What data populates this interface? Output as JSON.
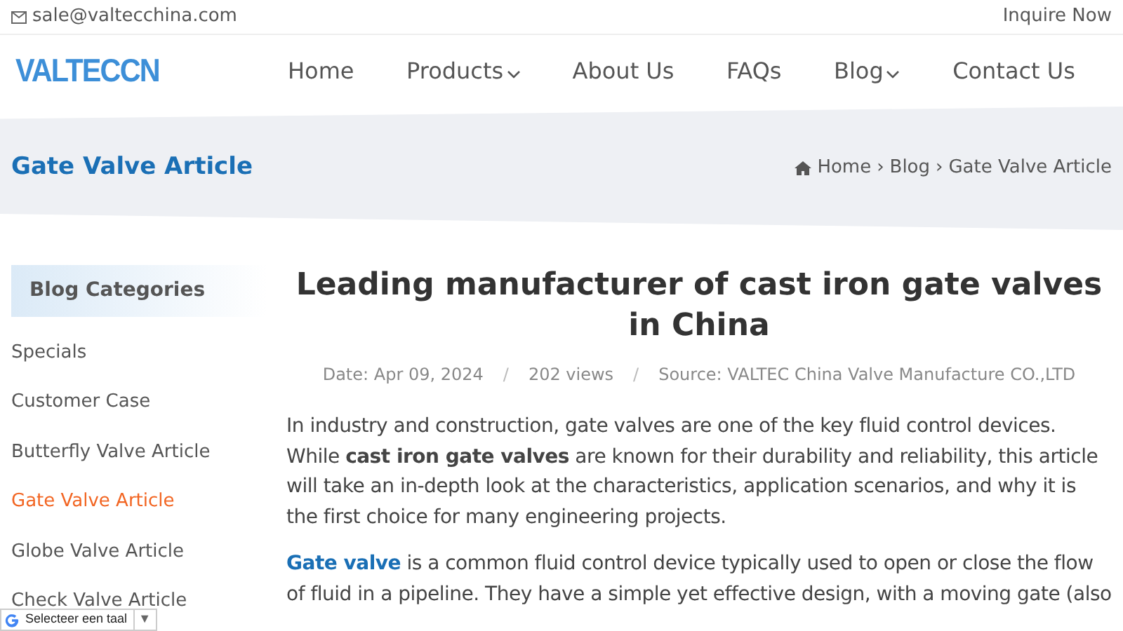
{
  "topbar": {
    "email": "sale@valtecchina.com",
    "inquire": "Inquire Now"
  },
  "logo": "VALTECCN",
  "nav": [
    {
      "label": "Home",
      "dropdown": false
    },
    {
      "label": "Products",
      "dropdown": true
    },
    {
      "label": "About Us",
      "dropdown": false
    },
    {
      "label": "FAQs",
      "dropdown": false
    },
    {
      "label": "Blog",
      "dropdown": true
    },
    {
      "label": "Contact Us",
      "dropdown": false
    }
  ],
  "banner": {
    "title": "Gate Valve Article",
    "breadcrumb": [
      "Home",
      "Blog",
      "Gate Valve Article"
    ],
    "separator": "›"
  },
  "sidebar": {
    "title": "Blog Categories",
    "items": [
      {
        "label": "Specials",
        "selected": false
      },
      {
        "label": "Customer Case",
        "selected": false
      },
      {
        "label": "Butterfly Valve Article",
        "selected": false
      },
      {
        "label": "Gate Valve Article",
        "selected": true
      },
      {
        "label": "Globe Valve Article",
        "selected": false
      },
      {
        "label": "Check Valve Article",
        "selected": false
      }
    ]
  },
  "article": {
    "title": "Leading manufacturer of cast iron gate valves in China",
    "meta": [
      "Date: Apr 09, 2024",
      "202 views",
      "Source: VALTEC China Valve Manufacture CO.,LTD"
    ],
    "meta_separator": "/",
    "paragraphs": [
      {
        "text": "In industry and construction, gate valves are one of the key fluid control devices. While **cast iron gate valves** are known for their durability and reliability, this article will take an in-depth look at the characteristics, application scenarios, and why it is the first choice for many engineering projects."
      },
      {
        "link": "Gate valve",
        "text": " is a common fluid control device typically used to open or close the flow of fluid in a pipeline. They have a simple yet effective design, with a moving gate (also"
      }
    ]
  },
  "translate": {
    "label": "Selecteer een taal",
    "arrow": "▼"
  }
}
